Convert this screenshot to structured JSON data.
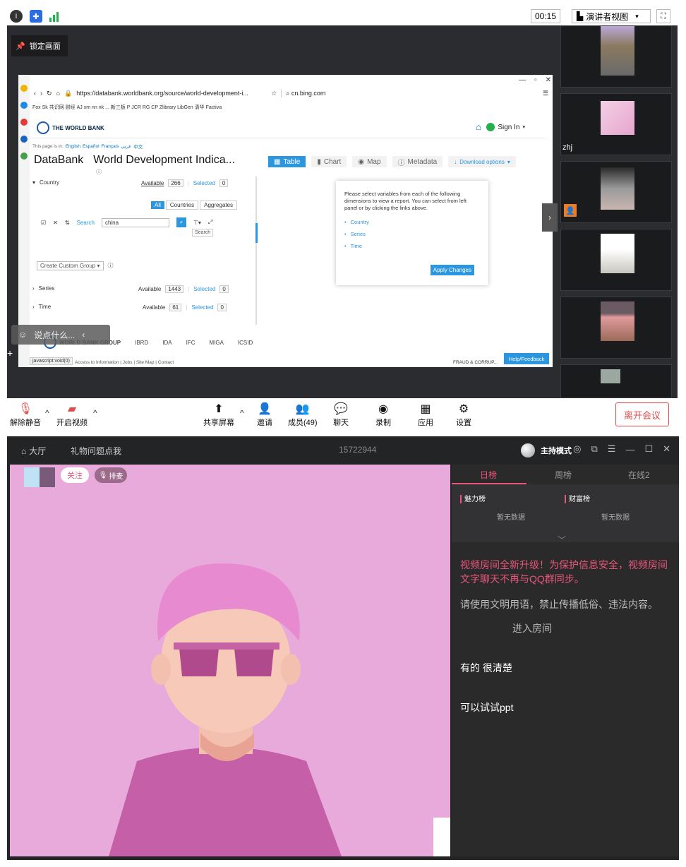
{
  "meeting": {
    "timer": "00:15",
    "view_label": "演讲者视图",
    "lock_label": "锁定画面",
    "chat_placeholder": "说点什么...",
    "leave_label": "离开会议",
    "participants": [
      {
        "name": ""
      },
      {
        "name": "zhj"
      },
      {
        "name": ""
      },
      {
        "name": ""
      },
      {
        "name": ""
      },
      {
        "name": ""
      }
    ],
    "toolbar": {
      "mute": "解除静音",
      "video": "开启视频",
      "share": "共享屏幕",
      "invite": "邀请",
      "members": "成员(49)",
      "chat": "聊天",
      "record": "录制",
      "apps": "应用",
      "settings": "设置"
    }
  },
  "browser": {
    "url": "https://databank.worldbank.org/source/world-development-i...",
    "search_text": "cn.bing.com",
    "bookmarks": "Fox  Sk  共识网  财经  AJ  xm  nn  nk  ... 新三板  P  JCR  RG  CP  Zlibrary  LibGen  清华  Factiva",
    "status_text": "javascript:void(0)",
    "footer_links": "Access to Information  |  Jobs  |  Site Map  |  Contact",
    "fraud_text": "FRAUD & CORRUP...",
    "feedback_label": "Help/Feedback"
  },
  "worldbank": {
    "logo_text": "THE WORLD BANK",
    "sign_in": "Sign In",
    "lang_intro": "This page is in:",
    "languages": [
      "English",
      "Español",
      "Français",
      "عربي",
      "中文"
    ],
    "databank": "DataBank",
    "title": "World Development Indica...",
    "tabs": [
      "Table",
      "Chart",
      "Map",
      "Metadata",
      "Download options"
    ],
    "country_label": "Country",
    "available_label": "Available",
    "selected_label": "Selected",
    "country_available": "266",
    "country_selected": "0",
    "filter_all": "All",
    "filter_countries": "Countries",
    "filter_aggregates": "Aggregates",
    "search_label": "Search",
    "search_value": "china",
    "search_tooltip": "Search",
    "custom_group": "Create Custom Group",
    "series_label": "Series",
    "series_available": "1443",
    "series_selected": "0",
    "time_label": "Time",
    "time_available": "61",
    "time_selected": "0",
    "info_text": "Please select variables from each of the following dimensions to view a report. You can select from left panel or by clicking the links above.",
    "info_items": [
      "Country",
      "Series",
      "Time"
    ],
    "apply_label": "Apply Changes",
    "footer_org": "WORLD BANK GROUP",
    "footer_members": [
      "IBRD",
      "IDA",
      "IFC",
      "MIGA",
      "ICSID"
    ]
  },
  "live": {
    "nav_home": "大厅",
    "nav_gifts": "礼物问题点我",
    "room_id": "15722944",
    "host_mode": "主持模式",
    "follow_label": "关注",
    "rank_label": "排麦",
    "tabs": [
      "日榜",
      "周榜",
      "在线2"
    ],
    "charm_rank": "魅力榜",
    "wealth_rank": "财富榜",
    "no_data": "暂无数据",
    "messages": {
      "notice": "视频房间全新升级！为保护信息安全，视频房间文字聊天不再与QQ群同步。",
      "rules": "请使用文明用语，禁止传播低俗、违法内容。",
      "enter": "进入房间",
      "m1": "有的 很清楚",
      "m2": "可以试试ppt"
    }
  },
  "colors": {
    "accent_pink": "#e8567a",
    "wb_blue": "#2c97de",
    "video_bg": "#e8aadb",
    "leave_red": "#e34a4a"
  }
}
